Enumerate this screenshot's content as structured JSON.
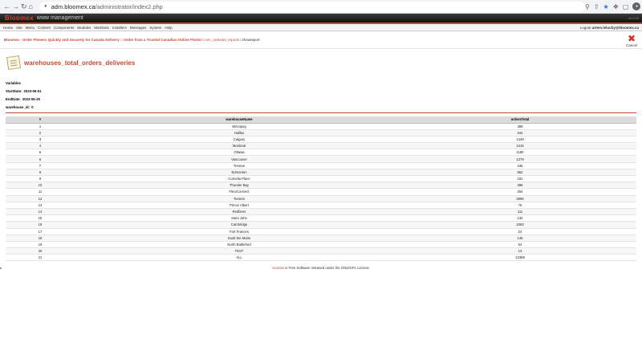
{
  "browser": {
    "url_host": "adm.bloomex.ca",
    "url_path": "/administrator/index2.php"
  },
  "header": {
    "brand": "Bloomex",
    "brand_sub": "www management",
    "version": "v1.0.15"
  },
  "menu": {
    "items": [
      "Home",
      "Site",
      "Menu",
      "Content",
      "Components",
      "Modules",
      "Mambots",
      "Installers",
      "Messages",
      "System",
      "Help"
    ],
    "logout_prefix": "Logout",
    "logout_user": "artem.leluchy@bloomex.ca"
  },
  "breadcrumb": {
    "site": "Bloomex - Order Flowers Quickly and Securely for Canada Delivery :: Order from a Trusted Canadian Online Florist",
    "component": "com_orderdel_reports",
    "current": "showreport"
  },
  "toolbar": {
    "cancel_label": "Cancel"
  },
  "report": {
    "title": "warehouses_total_orders_deliveries",
    "variables_label": "Variables",
    "start_label": "StartDate:",
    "start_value": "2023-06-01",
    "end_label": "EndDate:",
    "end_value": "2023-06-25",
    "wh_label": "warehouse_id:",
    "wh_value": "0",
    "columns": [
      "#",
      "warehouseName",
      "ordersTotal"
    ],
    "rows": [
      [
        "1",
        "Winnipeg",
        "389"
      ],
      [
        "2",
        "Halifax",
        "344"
      ],
      [
        "3",
        "Calgary",
        "1448"
      ],
      [
        "4",
        "Montreal",
        "1315"
      ],
      [
        "5",
        "Ottawa",
        "1180"
      ],
      [
        "6",
        "Vancouver",
        "1379"
      ],
      [
        "7",
        "Trenton",
        "346"
      ],
      [
        "8",
        "Edmonton",
        "862"
      ],
      [
        "9",
        "Cornelia Place",
        "181"
      ],
      [
        "10",
        "Thunder Bay",
        "398"
      ],
      [
        "11",
        "FleurConnect",
        "264"
      ],
      [
        "12",
        "Toronto",
        "2996"
      ],
      [
        "13",
        "Prince Albert",
        "76"
      ],
      [
        "14",
        "RedDeer",
        "111"
      ],
      [
        "15",
        "Saint John",
        "132"
      ],
      [
        "16",
        "Cambridge",
        "1093"
      ],
      [
        "17",
        "Fort Frances",
        "24"
      ],
      [
        "18",
        "Sault Ste Marie",
        "148"
      ],
      [
        "19",
        "North Battleford",
        "54"
      ],
      [
        "20",
        "TEST",
        "13"
      ],
      [
        "21",
        "ALL",
        "12389"
      ]
    ]
  },
  "footer": {
    "link": "Joomla!",
    "text": " is Free Software released under the GNU/GPL License."
  }
}
